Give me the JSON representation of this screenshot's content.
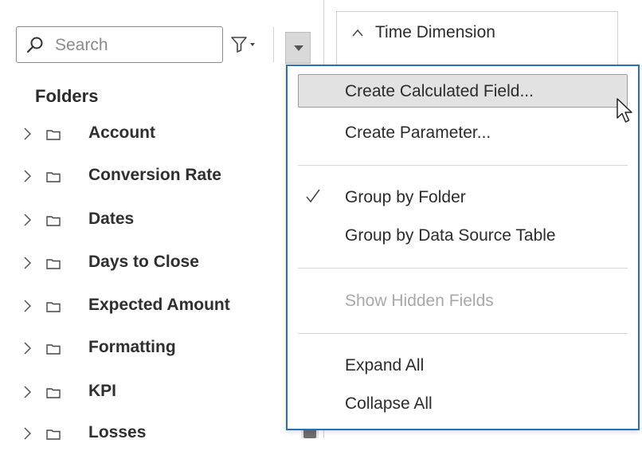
{
  "search": {
    "placeholder": "Search",
    "value": ""
  },
  "folders": {
    "title": "Folders",
    "items": [
      {
        "label": "Account"
      },
      {
        "label": "Conversion Rate"
      },
      {
        "label": "Dates"
      },
      {
        "label": "Days to Close"
      },
      {
        "label": "Expected Amount"
      },
      {
        "label": "Formatting"
      },
      {
        "label": "KPI"
      },
      {
        "label": "Losses"
      }
    ]
  },
  "time_dimension": {
    "title": "Time Dimension"
  },
  "menu": {
    "items": {
      "create_calculated_field": "Create Calculated Field...",
      "create_parameter": "Create Parameter...",
      "group_by_folder": "Group by Folder",
      "group_by_data_source_table": "Group by Data Source Table",
      "show_hidden_fields": "Show Hidden Fields",
      "expand_all": "Expand All",
      "collapse_all": "Collapse All"
    },
    "checked_item": "group_by_folder",
    "disabled_item": "show_hidden_fields",
    "hovered_item": "create_calculated_field"
  },
  "colors": {
    "menu_border": "#2d6db8",
    "hover_bg": "#e2e2e2",
    "disabled_text": "#a8a8a8"
  },
  "icons": {
    "search": "search-icon",
    "filter": "filter-icon",
    "menu_caret": "caret-down-icon",
    "tree_chevron": "chevron-right-icon",
    "folder": "folder-icon",
    "collapse": "chevron-up-icon",
    "check": "checkmark-icon",
    "cursor": "mouse-pointer-icon"
  }
}
